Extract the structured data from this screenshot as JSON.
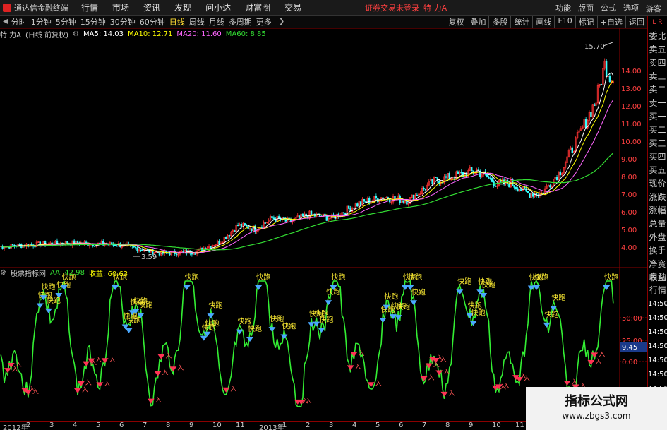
{
  "titlebar": {
    "app_title": "通达信金融终端",
    "menu": [
      "行情",
      "市场",
      "资讯",
      "发现",
      "问小达",
      "财富圈",
      "交易"
    ],
    "login_status": "证券交易未登录",
    "stock_name": "特 力A",
    "right_menu": [
      "功能",
      "版面",
      "公式",
      "选项"
    ],
    "guest": "游客"
  },
  "periodbar": {
    "periods": [
      "分时",
      "1分钟",
      "5分钟",
      "15分钟",
      "30分钟",
      "60分钟",
      "日线",
      "周线",
      "月线",
      "多周期",
      "更多"
    ],
    "active": "日线",
    "right_buttons": [
      "复权",
      "叠加",
      "多股",
      "统计",
      "画线",
      "F10",
      "标记",
      "+自选",
      "返回"
    ]
  },
  "main_indicator": {
    "stock_label": "特 力A",
    "adjust": "(日线 前复权)",
    "ma5": "MA5: 14.03",
    "ma10": "MA10: 12.71",
    "ma20": "MA20: 11.60",
    "ma60": "MA60: 8.85",
    "colors": {
      "ma5": "#ffffff",
      "ma10": "#ffff00",
      "ma20": "#ff66ff",
      "ma60": "#33dd33"
    },
    "high_label": "15.70",
    "low_label": "3.59",
    "y_ticks": [
      "14.00",
      "13.00",
      "12.00",
      "11.00",
      "10.00",
      "9.00",
      "8.00",
      "7.00",
      "6.00",
      "5.00",
      "4.00"
    ]
  },
  "sub_indicator": {
    "name": "股票指标网",
    "aa": "AA: 42.98",
    "gain": "收益: 60.63",
    "y_ticks": [
      "50.00",
      "25.00",
      "0.00"
    ],
    "current_value": "9.45",
    "signal_label": "快跑",
    "signal_in": "入"
  },
  "side_panel": {
    "top": "L R",
    "items": [
      "委比",
      "卖五",
      "卖四",
      "卖三",
      "卖二",
      "卖一",
      "买一",
      "买二",
      "买三",
      "买四",
      "买五",
      "现价",
      "涨跌",
      "涨幅",
      "总量",
      "外盘",
      "换手",
      "净资",
      "收益"
    ],
    "bottom_items": [
      "自动",
      "行情",
      "14:50",
      "14:50",
      "14:50",
      "14:50",
      "14:50",
      "14:50",
      "14:50",
      "14:50",
      "14:50"
    ]
  },
  "date_axis": [
    "2012年",
    "2",
    "3",
    "4",
    "5",
    "6",
    "7",
    "8",
    "9",
    "10",
    "11",
    "2013年",
    "1",
    "2",
    "3",
    "4",
    "5",
    "6",
    "7",
    "8",
    "9",
    "10",
    "11"
  ],
  "watermark": {
    "title": "指标公式网",
    "url": "www.zbgs3.com"
  }
}
